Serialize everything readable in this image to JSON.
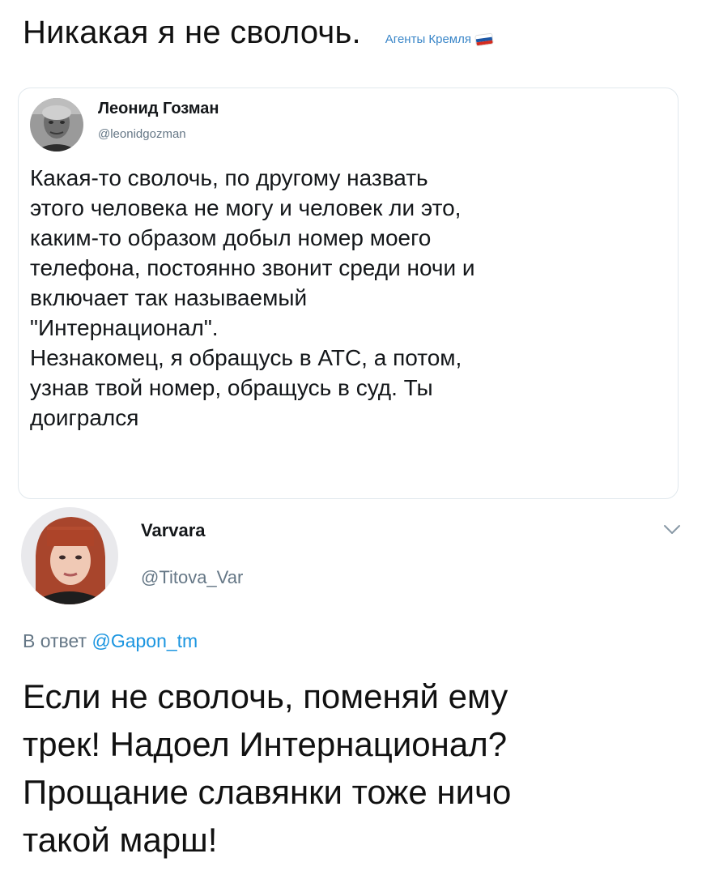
{
  "header": {
    "title": "Никакая я не сволочь.",
    "tag": "Агенты Кремля",
    "flag_colors": [
      "#ffffff",
      "#1c57a5",
      "#d52b1e"
    ],
    "flag_icon": "russian-flag-icon"
  },
  "quoted_tweet": {
    "author_name": "Леонид Гозман",
    "author_handle": "@leonidgozman",
    "avatar_icon": "profile-photo",
    "text": "Какая-то сволочь, по другому назвать\nэтого человека не могу и человек ли это,\nкаким-то образом добыл номер моего\nтелефона, постоянно звонит среди ночи и\nвключает так называемый\n\"Интернационал\".\nНезнакомец, я обращусь в АТС, а потом,\nузнав твой номер, обращусь в суд. Ты\nдоигрался"
  },
  "reply_tweet": {
    "author_name": "Varvara",
    "author_handle": "@Titova_Var",
    "avatar_icon": "profile-photo",
    "menu_icon": "chevron-down-icon",
    "reply_prefix": "В ответ",
    "reply_mention": "@Gapon_tm",
    "text": "Если не сволочь, поменяй ему\nтрек! Надоел Интернационал?\nПрощание славянки тоже ничо\nтакой марш!"
  },
  "colors": {
    "link": "#1b95e0",
    "secondary_text": "#657786",
    "border": "#e1e8ed"
  }
}
